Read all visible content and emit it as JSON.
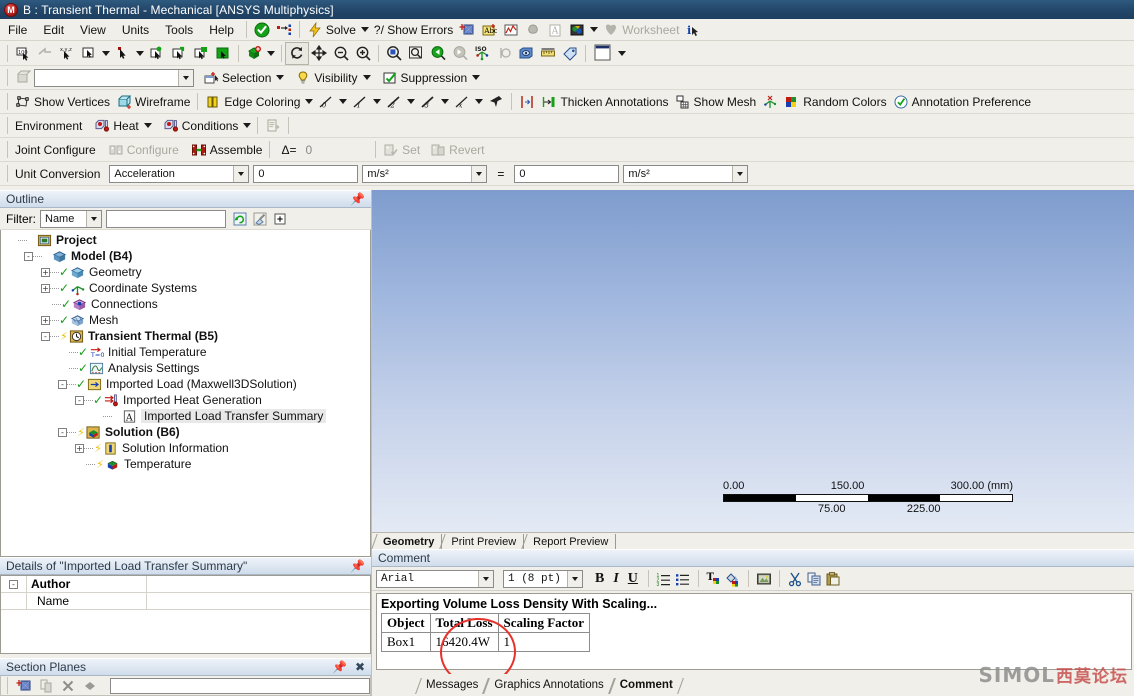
{
  "window": {
    "title": "B : Transient Thermal - Mechanical [ANSYS Multiphysics]",
    "logo_letter": "M"
  },
  "menubar": {
    "items": [
      "File",
      "Edit",
      "View",
      "Units",
      "Tools",
      "Help"
    ]
  },
  "toolbar_main": {
    "solve_label": "Solve",
    "show_errors_label": "?/ Show Errors",
    "worksheet_label": "Worksheet",
    "icons": [
      "green-check-icon",
      "named-selection-icon",
      "new-chart-icon",
      "new-comment-icon",
      "new-figure-icon",
      "new-image-icon",
      "new-annotation-icon",
      "new-section-plane-icon"
    ]
  },
  "toolbar_select": {
    "icons": [
      "select-box-icon",
      "extend-selection-icon",
      "xyz-probe-icon",
      "cursor-mode-icon",
      "single-select-icon",
      "vertex-select-icon",
      "edge-select-icon",
      "face-select-icon",
      "body-select-icon",
      "extend-to-icon",
      "rotate-icon",
      "pan-icon",
      "zoom-out-icon",
      "zoom-in-icon",
      "box-zoom-icon",
      "zoom-to-fit-icon",
      "previous-view-icon",
      "next-view-icon",
      "iso-view-icon",
      "set-view-icon",
      "magnify-icon",
      "ruler-icon",
      "label-icon",
      "color-swatch-icon"
    ]
  },
  "toolbar_selection": {
    "selection_label": "Selection",
    "visibility_label": "Visibility",
    "suppression_label": "Suppression",
    "combo_value": ""
  },
  "toolbar_display": {
    "show_vertices_label": "Show Vertices",
    "wireframe_label": "Wireframe",
    "edge_coloring_label": "Edge Coloring",
    "thicken_annotations_label": "Thicken Annotations",
    "show_mesh_label": "Show Mesh",
    "random_colors_label": "Random Colors",
    "annotation_preferences_label": "Annotation Preference",
    "edge_levels": [
      "0",
      "1",
      "2",
      "3",
      "x"
    ]
  },
  "toolbar_environment": {
    "environment_label": "Environment",
    "heat_label": "Heat",
    "conditions_label": "Conditions"
  },
  "toolbar_joint": {
    "joint_configure_label": "Joint Configure",
    "configure_label": "Configure",
    "assemble_label": "Assemble",
    "delta_label": "Δ=",
    "delta_value": "0",
    "set_label": "Set",
    "revert_label": "Revert"
  },
  "toolbar_units": {
    "unit_conversion_label": "Unit Conversion",
    "quantity": "Acceleration",
    "from_value": "0",
    "from_unit": "m/s²",
    "equals": "=",
    "to_value": "0",
    "to_unit": "m/s²"
  },
  "outline": {
    "title": "Outline",
    "filter_label": "Filter:",
    "filter_mode": "Name",
    "filter_value": "",
    "tree": [
      {
        "label": "Project",
        "indent": 0,
        "bold": true,
        "expander": "",
        "icon": "project-icon",
        "status": ""
      },
      {
        "label": "Model (B4)",
        "indent": 1,
        "bold": true,
        "expander": "-",
        "icon": "model-icon",
        "status": ""
      },
      {
        "label": "Geometry",
        "indent": 2,
        "bold": false,
        "expander": "+",
        "icon": "geometry-icon",
        "status": "check"
      },
      {
        "label": "Coordinate Systems",
        "indent": 2,
        "bold": false,
        "expander": "+",
        "icon": "coordinate-systems-icon",
        "status": "check"
      },
      {
        "label": "Connections",
        "indent": 2,
        "bold": false,
        "expander": "",
        "icon": "connections-icon",
        "status": "check"
      },
      {
        "label": "Mesh",
        "indent": 2,
        "bold": false,
        "expander": "+",
        "icon": "mesh-icon",
        "status": "check"
      },
      {
        "label": "Transient Thermal (B5)",
        "indent": 2,
        "bold": true,
        "expander": "-",
        "icon": "transient-thermal-icon",
        "status": "bolt"
      },
      {
        "label": "Initial Temperature",
        "indent": 3,
        "bold": false,
        "expander": "",
        "icon": "initial-temperature-icon",
        "status": "check"
      },
      {
        "label": "Analysis Settings",
        "indent": 3,
        "bold": false,
        "expander": "",
        "icon": "analysis-settings-icon",
        "status": "check"
      },
      {
        "label": "Imported Load (Maxwell3DSolution)",
        "indent": 3,
        "bold": false,
        "expander": "-",
        "icon": "imported-load-icon",
        "status": "check"
      },
      {
        "label": "Imported Heat Generation",
        "indent": 4,
        "bold": false,
        "expander": "-",
        "icon": "imported-heat-generation-icon",
        "status": "check"
      },
      {
        "label": "Imported Load Transfer Summary",
        "indent": 5,
        "bold": false,
        "expander": "",
        "icon": "annotation-a-icon",
        "status": "selected"
      },
      {
        "label": "Solution (B6)",
        "indent": 3,
        "bold": true,
        "expander": "-",
        "icon": "solution-icon",
        "status": "bolt"
      },
      {
        "label": "Solution Information",
        "indent": 4,
        "bold": false,
        "expander": "+",
        "icon": "solution-information-icon",
        "status": "bolt"
      },
      {
        "label": "Temperature",
        "indent": 4,
        "bold": false,
        "expander": "",
        "icon": "temperature-result-icon",
        "status": "bolt"
      }
    ]
  },
  "details": {
    "title": "Details of \"Imported Load Transfer Summary\"",
    "rows": [
      {
        "group": "Author",
        "expander": "-",
        "is_group": true,
        "value": ""
      },
      {
        "group": "Name",
        "expander": "",
        "is_group": false,
        "value": ""
      }
    ]
  },
  "section_planes": {
    "title": "Section Planes",
    "icons": [
      "new-section-plane-icon",
      "copy-section-plane-icon",
      "delete-section-plane-icon",
      "edit-section-plane-icon"
    ],
    "field_value": ""
  },
  "viewport": {
    "scale": {
      "top_labels": [
        "0.00",
        "150.00",
        "300.00 (mm)"
      ],
      "bottom_labels": [
        "75.00",
        "225.00"
      ],
      "segment_colors": [
        "#000000",
        "#ffffff",
        "#000000",
        "#ffffff"
      ]
    },
    "tabs": [
      {
        "label": "Geometry",
        "active": true
      },
      {
        "label": "Print Preview",
        "active": false
      },
      {
        "label": "Report Preview",
        "active": false
      }
    ]
  },
  "comment": {
    "title": "Comment",
    "font_name": "Arial",
    "font_size": "1  (8 pt)",
    "format_buttons": [
      "B",
      "I",
      "U"
    ],
    "tool_icons": [
      "numbered-list-icon",
      "bullet-list-icon",
      "text-color-icon",
      "fill-color-icon",
      "insert-image-icon",
      "cut-icon",
      "copy-icon",
      "paste-icon"
    ],
    "body_heading": "Exporting Volume Loss Density With Scaling...",
    "table": {
      "headers": [
        "Object",
        "Total Loss",
        "Scaling Factor"
      ],
      "rows": [
        [
          "Box1",
          "16420.4W",
          "1"
        ]
      ]
    },
    "annotation_color": "#e8312a"
  },
  "bottom_tabs": [
    {
      "label": "Messages",
      "active": false
    },
    {
      "label": "Graphics Annotations",
      "active": false
    },
    {
      "label": "Comment",
      "active": true
    }
  ],
  "watermark": {
    "text_latin": "SIMOL",
    "text_cjk": "西莫论坛"
  }
}
